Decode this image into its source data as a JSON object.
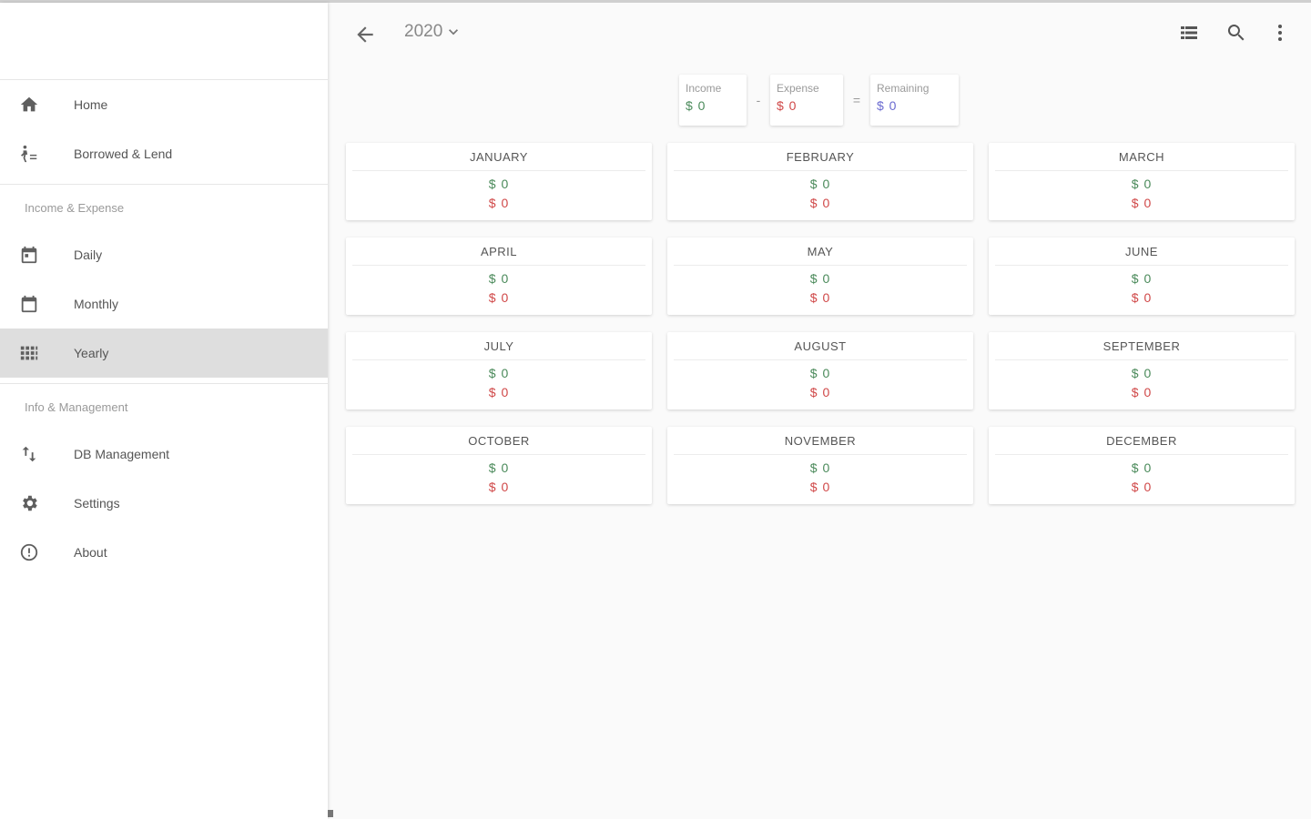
{
  "colors": {
    "income": "#4a8a5a",
    "expense": "#d04848",
    "remaining": "#6a6ad0"
  },
  "sidebar": {
    "main_items": [
      {
        "label": "Home",
        "icon": "home-icon"
      },
      {
        "label": "Borrowed & Lend",
        "icon": "person-list-icon"
      }
    ],
    "section_income_expense": "Income & Expense",
    "period_items": [
      {
        "label": "Daily",
        "icon": "calendar-day-icon"
      },
      {
        "label": "Monthly",
        "icon": "calendar-month-icon"
      },
      {
        "label": "Yearly",
        "icon": "grid-icon",
        "active": true
      }
    ],
    "section_info": "Info & Management",
    "info_items": [
      {
        "label": "DB Management",
        "icon": "swap-vertical-icon"
      },
      {
        "label": "Settings",
        "icon": "gear-icon"
      },
      {
        "label": "About",
        "icon": "info-icon"
      }
    ]
  },
  "appbar": {
    "back_icon": "arrow-back-icon",
    "year": "2020",
    "year_dropdown_icon": "chevron-down-icon",
    "actions": [
      "list-view-icon",
      "search-icon",
      "more-vert-icon"
    ]
  },
  "summary": {
    "income_label": "Income",
    "income_value": "$ 0",
    "minus": "-",
    "expense_label": "Expense",
    "expense_value": "$ 0",
    "equals": "=",
    "remaining_label": "Remaining",
    "remaining_value": "$ 0"
  },
  "months": [
    {
      "name": "JANUARY",
      "income": "$ 0",
      "expense": "$ 0"
    },
    {
      "name": "FEBRUARY",
      "income": "$ 0",
      "expense": "$ 0"
    },
    {
      "name": "MARCH",
      "income": "$ 0",
      "expense": "$ 0"
    },
    {
      "name": "APRIL",
      "income": "$ 0",
      "expense": "$ 0"
    },
    {
      "name": "MAY",
      "income": "$ 0",
      "expense": "$ 0"
    },
    {
      "name": "JUNE",
      "income": "$ 0",
      "expense": "$ 0"
    },
    {
      "name": "JULY",
      "income": "$ 0",
      "expense": "$ 0"
    },
    {
      "name": "AUGUST",
      "income": "$ 0",
      "expense": "$ 0"
    },
    {
      "name": "SEPTEMBER",
      "income": "$ 0",
      "expense": "$ 0"
    },
    {
      "name": "OCTOBER",
      "income": "$ 0",
      "expense": "$ 0"
    },
    {
      "name": "NOVEMBER",
      "income": "$ 0",
      "expense": "$ 0"
    },
    {
      "name": "DECEMBER",
      "income": "$ 0",
      "expense": "$ 0"
    }
  ]
}
